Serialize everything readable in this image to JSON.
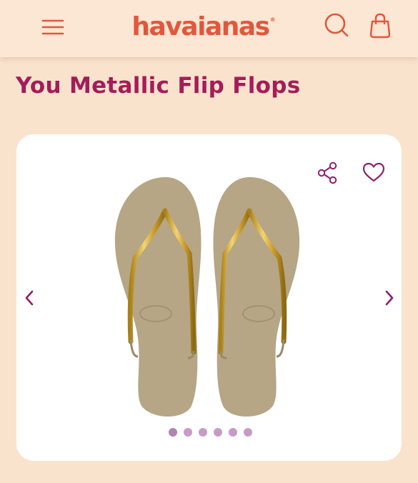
{
  "header": {
    "brand": "havaianas",
    "brand_mark": "®",
    "menu_icon": "hamburger-menu-icon",
    "search_icon": "search-icon",
    "bag_icon": "shopping-bag-icon"
  },
  "product": {
    "title": "You Metallic Flip Flops"
  },
  "gallery": {
    "image_alt": "You Metallic Flip Flops - sand grey sole with gold metallic straps",
    "share_icon": "share-icon",
    "wishlist_icon": "heart-icon",
    "prev_icon": "chevron-left-icon",
    "next_icon": "chevron-right-icon",
    "slide_count": 6,
    "active_slide": 1
  },
  "colors": {
    "page_bg": "#fae3cd",
    "brand_orange": "#e2573c",
    "title_magenta": "#a51c5a",
    "icon_purple": "#8e1f6a",
    "dot": "#c79bc8",
    "sole": "#b7a888",
    "strap_gold": "#d4a82e"
  }
}
